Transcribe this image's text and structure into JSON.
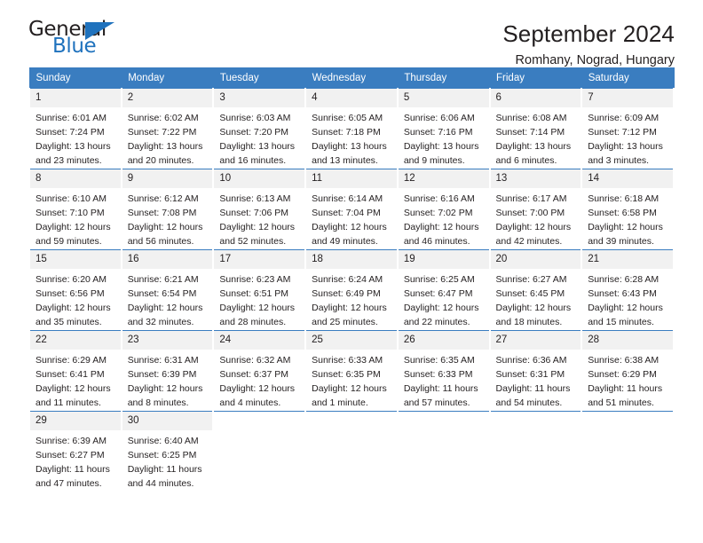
{
  "brand": {
    "name_top": "General",
    "name_bottom": "Blue",
    "accent_color": "#1f72bd"
  },
  "header": {
    "title": "September 2024",
    "subtitle": "Romhany, Nograd, Hungary"
  },
  "calendar": {
    "header_color": "#3a7dc0",
    "weekday_headers": [
      "Sunday",
      "Monday",
      "Tuesday",
      "Wednesday",
      "Thursday",
      "Friday",
      "Saturday"
    ],
    "weeks": [
      [
        {
          "day": "1",
          "sunrise": "Sunrise: 6:01 AM",
          "sunset": "Sunset: 7:24 PM",
          "daylight_line1": "Daylight: 13 hours",
          "daylight_line2": "and 23 minutes."
        },
        {
          "day": "2",
          "sunrise": "Sunrise: 6:02 AM",
          "sunset": "Sunset: 7:22 PM",
          "daylight_line1": "Daylight: 13 hours",
          "daylight_line2": "and 20 minutes."
        },
        {
          "day": "3",
          "sunrise": "Sunrise: 6:03 AM",
          "sunset": "Sunset: 7:20 PM",
          "daylight_line1": "Daylight: 13 hours",
          "daylight_line2": "and 16 minutes."
        },
        {
          "day": "4",
          "sunrise": "Sunrise: 6:05 AM",
          "sunset": "Sunset: 7:18 PM",
          "daylight_line1": "Daylight: 13 hours",
          "daylight_line2": "and 13 minutes."
        },
        {
          "day": "5",
          "sunrise": "Sunrise: 6:06 AM",
          "sunset": "Sunset: 7:16 PM",
          "daylight_line1": "Daylight: 13 hours",
          "daylight_line2": "and 9 minutes."
        },
        {
          "day": "6",
          "sunrise": "Sunrise: 6:08 AM",
          "sunset": "Sunset: 7:14 PM",
          "daylight_line1": "Daylight: 13 hours",
          "daylight_line2": "and 6 minutes."
        },
        {
          "day": "7",
          "sunrise": "Sunrise: 6:09 AM",
          "sunset": "Sunset: 7:12 PM",
          "daylight_line1": "Daylight: 13 hours",
          "daylight_line2": "and 3 minutes."
        }
      ],
      [
        {
          "day": "8",
          "sunrise": "Sunrise: 6:10 AM",
          "sunset": "Sunset: 7:10 PM",
          "daylight_line1": "Daylight: 12 hours",
          "daylight_line2": "and 59 minutes."
        },
        {
          "day": "9",
          "sunrise": "Sunrise: 6:12 AM",
          "sunset": "Sunset: 7:08 PM",
          "daylight_line1": "Daylight: 12 hours",
          "daylight_line2": "and 56 minutes."
        },
        {
          "day": "10",
          "sunrise": "Sunrise: 6:13 AM",
          "sunset": "Sunset: 7:06 PM",
          "daylight_line1": "Daylight: 12 hours",
          "daylight_line2": "and 52 minutes."
        },
        {
          "day": "11",
          "sunrise": "Sunrise: 6:14 AM",
          "sunset": "Sunset: 7:04 PM",
          "daylight_line1": "Daylight: 12 hours",
          "daylight_line2": "and 49 minutes."
        },
        {
          "day": "12",
          "sunrise": "Sunrise: 6:16 AM",
          "sunset": "Sunset: 7:02 PM",
          "daylight_line1": "Daylight: 12 hours",
          "daylight_line2": "and 46 minutes."
        },
        {
          "day": "13",
          "sunrise": "Sunrise: 6:17 AM",
          "sunset": "Sunset: 7:00 PM",
          "daylight_line1": "Daylight: 12 hours",
          "daylight_line2": "and 42 minutes."
        },
        {
          "day": "14",
          "sunrise": "Sunrise: 6:18 AM",
          "sunset": "Sunset: 6:58 PM",
          "daylight_line1": "Daylight: 12 hours",
          "daylight_line2": "and 39 minutes."
        }
      ],
      [
        {
          "day": "15",
          "sunrise": "Sunrise: 6:20 AM",
          "sunset": "Sunset: 6:56 PM",
          "daylight_line1": "Daylight: 12 hours",
          "daylight_line2": "and 35 minutes."
        },
        {
          "day": "16",
          "sunrise": "Sunrise: 6:21 AM",
          "sunset": "Sunset: 6:54 PM",
          "daylight_line1": "Daylight: 12 hours",
          "daylight_line2": "and 32 minutes."
        },
        {
          "day": "17",
          "sunrise": "Sunrise: 6:23 AM",
          "sunset": "Sunset: 6:51 PM",
          "daylight_line1": "Daylight: 12 hours",
          "daylight_line2": "and 28 minutes."
        },
        {
          "day": "18",
          "sunrise": "Sunrise: 6:24 AM",
          "sunset": "Sunset: 6:49 PM",
          "daylight_line1": "Daylight: 12 hours",
          "daylight_line2": "and 25 minutes."
        },
        {
          "day": "19",
          "sunrise": "Sunrise: 6:25 AM",
          "sunset": "Sunset: 6:47 PM",
          "daylight_line1": "Daylight: 12 hours",
          "daylight_line2": "and 22 minutes."
        },
        {
          "day": "20",
          "sunrise": "Sunrise: 6:27 AM",
          "sunset": "Sunset: 6:45 PM",
          "daylight_line1": "Daylight: 12 hours",
          "daylight_line2": "and 18 minutes."
        },
        {
          "day": "21",
          "sunrise": "Sunrise: 6:28 AM",
          "sunset": "Sunset: 6:43 PM",
          "daylight_line1": "Daylight: 12 hours",
          "daylight_line2": "and 15 minutes."
        }
      ],
      [
        {
          "day": "22",
          "sunrise": "Sunrise: 6:29 AM",
          "sunset": "Sunset: 6:41 PM",
          "daylight_line1": "Daylight: 12 hours",
          "daylight_line2": "and 11 minutes."
        },
        {
          "day": "23",
          "sunrise": "Sunrise: 6:31 AM",
          "sunset": "Sunset: 6:39 PM",
          "daylight_line1": "Daylight: 12 hours",
          "daylight_line2": "and 8 minutes."
        },
        {
          "day": "24",
          "sunrise": "Sunrise: 6:32 AM",
          "sunset": "Sunset: 6:37 PM",
          "daylight_line1": "Daylight: 12 hours",
          "daylight_line2": "and 4 minutes."
        },
        {
          "day": "25",
          "sunrise": "Sunrise: 6:33 AM",
          "sunset": "Sunset: 6:35 PM",
          "daylight_line1": "Daylight: 12 hours",
          "daylight_line2": "and 1 minute."
        },
        {
          "day": "26",
          "sunrise": "Sunrise: 6:35 AM",
          "sunset": "Sunset: 6:33 PM",
          "daylight_line1": "Daylight: 11 hours",
          "daylight_line2": "and 57 minutes."
        },
        {
          "day": "27",
          "sunrise": "Sunrise: 6:36 AM",
          "sunset": "Sunset: 6:31 PM",
          "daylight_line1": "Daylight: 11 hours",
          "daylight_line2": "and 54 minutes."
        },
        {
          "day": "28",
          "sunrise": "Sunrise: 6:38 AM",
          "sunset": "Sunset: 6:29 PM",
          "daylight_line1": "Daylight: 11 hours",
          "daylight_line2": "and 51 minutes."
        }
      ],
      [
        {
          "day": "29",
          "sunrise": "Sunrise: 6:39 AM",
          "sunset": "Sunset: 6:27 PM",
          "daylight_line1": "Daylight: 11 hours",
          "daylight_line2": "and 47 minutes."
        },
        {
          "day": "30",
          "sunrise": "Sunrise: 6:40 AM",
          "sunset": "Sunset: 6:25 PM",
          "daylight_line1": "Daylight: 11 hours",
          "daylight_line2": "and 44 minutes."
        },
        {
          "day": "",
          "sunrise": "",
          "sunset": "",
          "daylight_line1": "",
          "daylight_line2": ""
        },
        {
          "day": "",
          "sunrise": "",
          "sunset": "",
          "daylight_line1": "",
          "daylight_line2": ""
        },
        {
          "day": "",
          "sunrise": "",
          "sunset": "",
          "daylight_line1": "",
          "daylight_line2": ""
        },
        {
          "day": "",
          "sunrise": "",
          "sunset": "",
          "daylight_line1": "",
          "daylight_line2": ""
        },
        {
          "day": "",
          "sunrise": "",
          "sunset": "",
          "daylight_line1": "",
          "daylight_line2": ""
        }
      ]
    ]
  }
}
